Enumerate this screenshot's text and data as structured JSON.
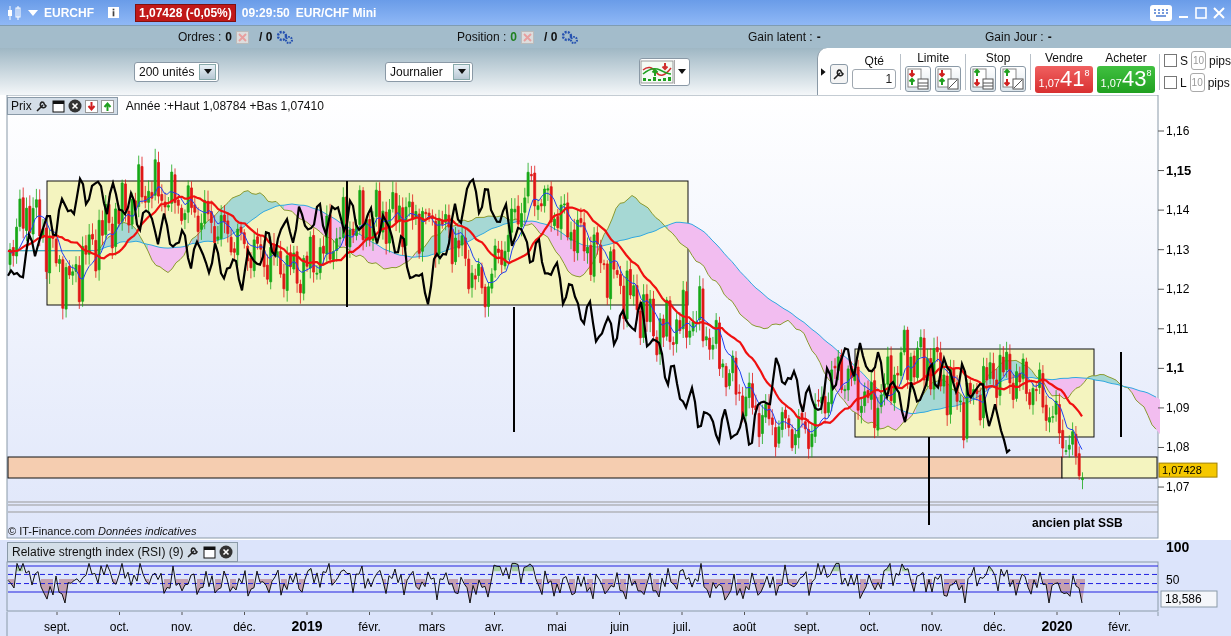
{
  "title_bar": {
    "symbol": "EURCHF",
    "price_change": "1,07428 (-0,05%)",
    "time": "09:29:50",
    "instrument": "EUR/CHF Mini"
  },
  "account_bar": {
    "orders": {
      "label": "Ordres :",
      "count": "0",
      "total": "/ 0"
    },
    "position": {
      "label": "Position :",
      "count": "0",
      "total": "/ 0"
    },
    "gain_latent": {
      "label": "Gain latent :",
      "value": "-"
    },
    "gain_day": {
      "label": "Gain Jour :",
      "value": "-"
    }
  },
  "toolbar": {
    "quantity_dropdown": "200 unités",
    "period_dropdown": "Journalier"
  },
  "order_panel": {
    "quantity": {
      "label": "Qté",
      "value": "1"
    },
    "limit": {
      "label": "Limite"
    },
    "stop": {
      "label": "Stop"
    },
    "sell": {
      "label": "Vendre",
      "prefix": "1,07",
      "big": "41",
      "sup": "8"
    },
    "buy": {
      "label": "Acheter",
      "prefix": "1,07",
      "big": "43",
      "sup": "8"
    },
    "options": [
      {
        "label": "S",
        "checked": false,
        "placeholder": "10",
        "unit": "pips"
      },
      {
        "label": "L",
        "checked": false,
        "placeholder": "10",
        "unit": "pips"
      }
    ]
  },
  "price_chart": {
    "title": "Prix",
    "range_info": "Année :+Haut 1,08784 +Bas 1,07410",
    "yticks": [
      {
        "label": "1,16",
        "bold": false
      },
      {
        "label": "1,15",
        "bold": true
      },
      {
        "label": "1,14",
        "bold": false
      },
      {
        "label": "1,13",
        "bold": false
      },
      {
        "label": "1,12",
        "bold": false
      },
      {
        "label": "1,11",
        "bold": false
      },
      {
        "label": "1,1",
        "bold": true
      },
      {
        "label": "1,09",
        "bold": false
      },
      {
        "label": "1,08",
        "bold": false
      },
      {
        "label": "1,07",
        "bold": false
      }
    ],
    "last_price": "1,07428",
    "annotation": "ancien plat SSB",
    "copyright": "© IT-Finance.com *Données indicatives*"
  },
  "rsi_panel": {
    "title": "Relative strength index (RSI) (9)",
    "yticks": [
      {
        "label": "100",
        "bold": true
      },
      {
        "label": "50",
        "bold": false
      }
    ],
    "last_value": "18,586"
  },
  "x_axis": [
    {
      "label": "sept.",
      "bold": false
    },
    {
      "label": "oct.",
      "bold": false
    },
    {
      "label": "nov.",
      "bold": false
    },
    {
      "label": "déc.",
      "bold": false
    },
    {
      "label": "2019",
      "bold": true
    },
    {
      "label": "févr.",
      "bold": false
    },
    {
      "label": "mars",
      "bold": false
    },
    {
      "label": "avr.",
      "bold": false
    },
    {
      "label": "mai",
      "bold": false
    },
    {
      "label": "juin",
      "bold": false
    },
    {
      "label": "juil.",
      "bold": false
    },
    {
      "label": "août",
      "bold": false
    },
    {
      "label": "sept.",
      "bold": false
    },
    {
      "label": "oct.",
      "bold": false
    },
    {
      "label": "nov.",
      "bold": false
    },
    {
      "label": "déc.",
      "bold": false
    },
    {
      "label": "2020",
      "bold": true
    },
    {
      "label": "févr.",
      "bold": false
    }
  ]
}
